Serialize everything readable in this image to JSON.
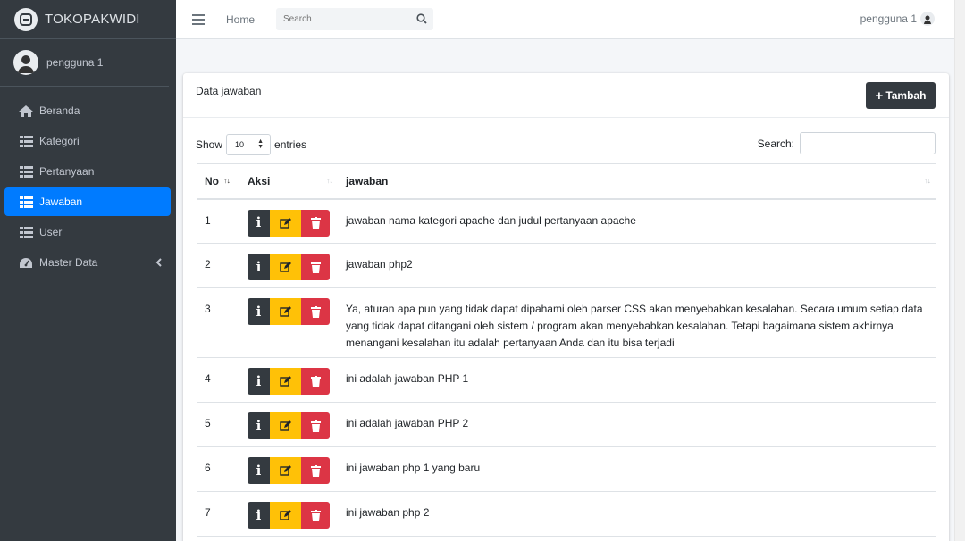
{
  "brand": {
    "name": "TOKOPAKWIDI"
  },
  "user": {
    "name": "pengguna 1"
  },
  "sidebar": {
    "items": [
      {
        "label": "Beranda",
        "icon": "home-icon"
      },
      {
        "label": "Kategori",
        "icon": "grid-icon"
      },
      {
        "label": "Pertanyaan",
        "icon": "grid-icon"
      },
      {
        "label": "Jawaban",
        "icon": "grid-icon",
        "active": true
      },
      {
        "label": "User",
        "icon": "grid-icon"
      },
      {
        "label": "Master Data",
        "icon": "dashboard-icon"
      }
    ]
  },
  "topbar": {
    "home_label": "Home",
    "search_placeholder": "Search",
    "user_name": "pengguna 1"
  },
  "card": {
    "title": "Data jawaban",
    "add_button": "Tambah"
  },
  "table_controls": {
    "show_label": "Show",
    "entries_value": "10",
    "entries_label": "entries",
    "search_label": "Search:"
  },
  "table": {
    "headers": [
      "No",
      "Aksi",
      "jawaban"
    ],
    "rows": [
      {
        "no": "1",
        "jawaban": "jawaban nama kategori apache dan judul pertanyaan apache"
      },
      {
        "no": "2",
        "jawaban": "jawaban php2"
      },
      {
        "no": "3",
        "jawaban": "Ya, aturan apa pun yang tidak dapat dipahami oleh parser CSS akan menyebabkan kesalahan. Secara umum setiap data yang tidak dapat ditangani oleh sistem / program akan menyebabkan kesalahan. Tetapi bagaimana sistem akhirnya menangani kesalahan itu adalah pertanyaan Anda dan itu bisa terjadi"
      },
      {
        "no": "4",
        "jawaban": "ini adalah jawaban PHP 1"
      },
      {
        "no": "5",
        "jawaban": "ini adalah jawaban PHP 2"
      },
      {
        "no": "6",
        "jawaban": "ini jawaban php 1 yang baru"
      },
      {
        "no": "7",
        "jawaban": "ini jawaban php 2"
      }
    ]
  },
  "colors": {
    "sidebar_bg": "#343a40",
    "active": "#007bff",
    "info": "#343a40",
    "edit": "#ffc107",
    "delete": "#dc3545"
  }
}
